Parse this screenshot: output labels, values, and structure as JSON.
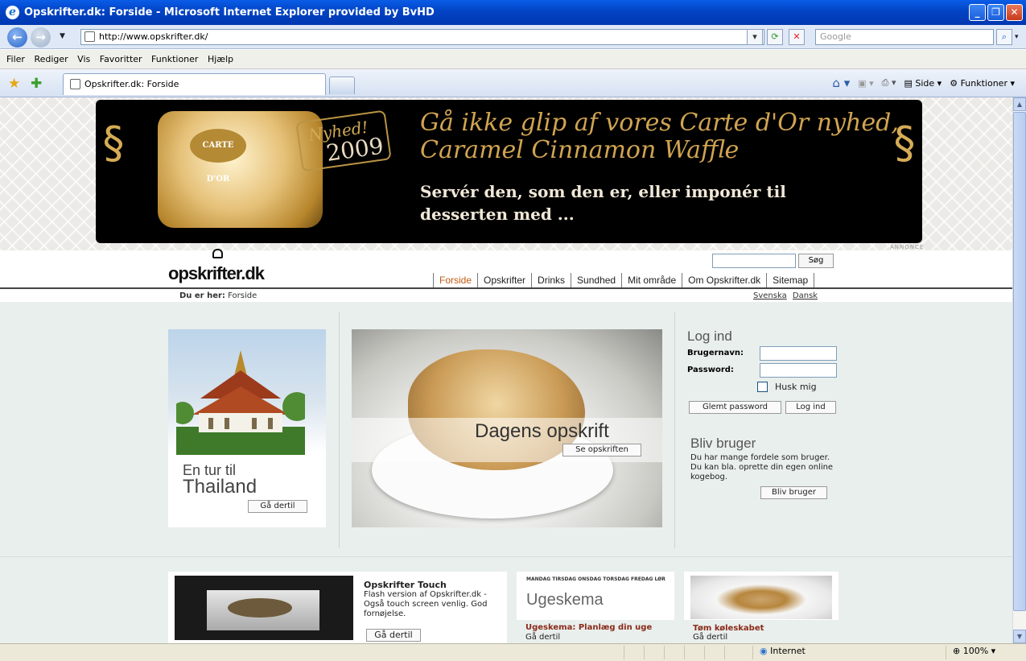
{
  "window": {
    "title": "Opskrifter.dk: Forside - Microsoft Internet Explorer provided by BvHD"
  },
  "address": {
    "url": "http://www.opskrifter.dk/",
    "search_placeholder": "Google"
  },
  "menu": [
    "Filer",
    "Rediger",
    "Vis",
    "Favoritter",
    "Funktioner",
    "Hjælp"
  ],
  "tab": {
    "label": "Opskrifter.dk: Forside"
  },
  "commandbar": {
    "page": "Side",
    "tools": "Funktioner"
  },
  "banner": {
    "badge_text": "Nyhed!",
    "badge_year": "2009",
    "product_brand": "CARTE D'OR",
    "headline_1": "Gå ikke glip af vores Carte d'Or nyhed,",
    "headline_2": "Caramel Cinnamon Waffle",
    "subline": "Servér den, som den er, eller imponér til desserten med ...",
    "ad_label": "ANNONCE"
  },
  "site": {
    "logo": "opskrifter.dk",
    "search_button": "Søg",
    "nav": [
      "Forside",
      "Opskrifter",
      "Drinks",
      "Sundhed",
      "Mit område",
      "Om Opskrifter.dk",
      "Sitemap"
    ],
    "breadcrumb_label": "Du er her:",
    "breadcrumb_current": "Forside",
    "languages": [
      "Svenska",
      "Dansk"
    ]
  },
  "promo": {
    "line1": "En tur til",
    "line2": "Thailand",
    "button": "Gå dertil"
  },
  "recipe_of_day": {
    "title": "Dagens opskrift",
    "button": "Se opskriften"
  },
  "login": {
    "title": "Log ind",
    "username_label": "Brugernavn:",
    "password_label": "Password:",
    "remember_label": "Husk mig",
    "forgot_button": "Glemt password",
    "login_button": "Log ind"
  },
  "signup": {
    "title": "Bliv bruger",
    "text": "Du har mange fordele som bruger. Du kan bla. oprette din egen online kogebog.",
    "button": "Bliv bruger"
  },
  "cards": {
    "touch": {
      "title": "Opskrifter Touch",
      "text": "Flash version af Opskrifter.dk - Også touch screen venlig. God fornøjelse.",
      "button": "Gå dertil"
    },
    "week": {
      "days": "MANDAG TIRSDAG ONSDAG TORSDAG FREDAG LØR",
      "image_title": "Ugeskema",
      "title": "Ugeskema: Planlæg din uge",
      "link": "Gå dertil"
    },
    "fridge": {
      "title": "Tøm køleskabet",
      "link": "Gå dertil"
    }
  },
  "status": {
    "zone": "Internet",
    "zoom": "100%"
  },
  "colors": {
    "ie_blue": "#0243c4",
    "nav_active": "#c45a10",
    "page_bg": "#e9efec"
  }
}
